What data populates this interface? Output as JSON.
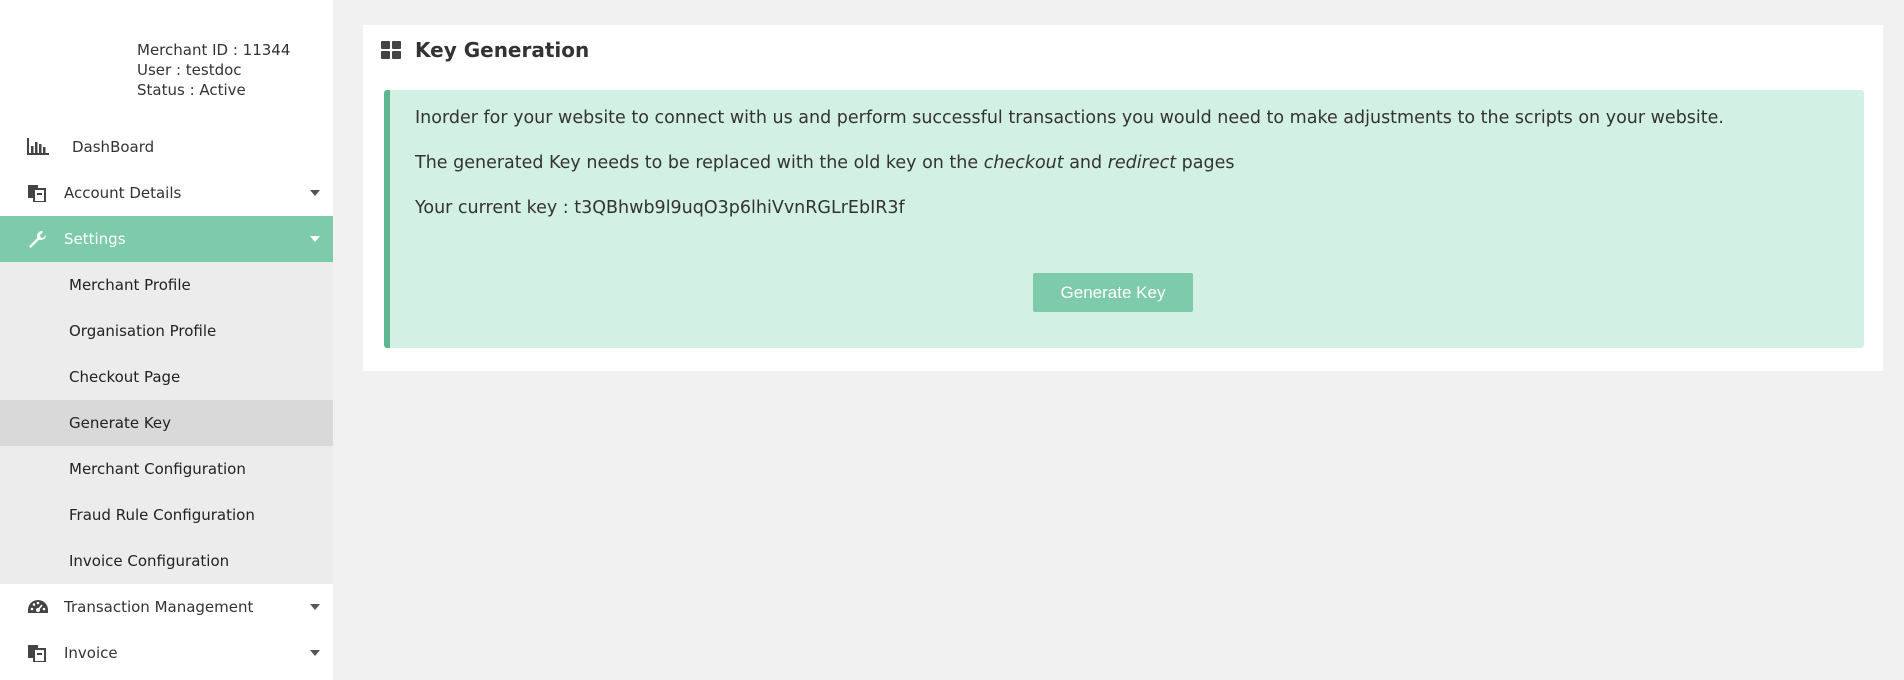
{
  "merchant": {
    "id_line": "Merchant ID : 11344",
    "user_line": "User : testdoc",
    "status_line": "Status : Active"
  },
  "nav": {
    "dashboard": "DashBoard",
    "account_details": "Account Details",
    "settings": "Settings",
    "settings_sub": [
      "Merchant Profile",
      "Organisation Profile",
      "Checkout Page",
      "Generate Key",
      "Merchant Configuration",
      "Fraud Rule Configuration",
      "Invoice Configuration"
    ],
    "transaction_management": "Transaction Management",
    "invoice": "Invoice"
  },
  "panel": {
    "title": "Key Generation",
    "line1": "Inorder for your website to connect with us and perform successful transactions you would need to make adjustments to the scripts on your website.",
    "line2_pre": "The generated Key needs to be replaced with the old key on the ",
    "line2_em1": "checkout",
    "line2_mid": " and ",
    "line2_em2": "redirect",
    "line2_post": " pages",
    "key_line": "Your current key : t3QBhwb9l9uqO3p6lhiVvnRGLrEbIR3f",
    "button": "Generate Key"
  },
  "colors": {
    "accent": "#7dcbab",
    "alert_bg": "#d2f0e3",
    "alert_border": "#5fb791"
  }
}
